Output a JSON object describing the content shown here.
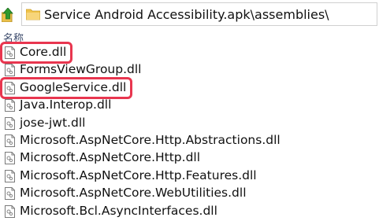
{
  "address_bar": {
    "up_icon": "green-up-arrow-icon",
    "folder_icon": "folder-icon",
    "path": "Service Android Accessibility.apk\\assemblies\\"
  },
  "list": {
    "column_header": "名称",
    "files": [
      {
        "name": "Core.dll",
        "icon": "dll-file-icon",
        "highlighted": true
      },
      {
        "name": "FormsViewGroup.dll",
        "icon": "dll-file-icon",
        "highlighted": false
      },
      {
        "name": "GoogleService.dll",
        "icon": "dll-file-icon",
        "highlighted": true
      },
      {
        "name": "Java.Interop.dll",
        "icon": "dll-file-icon",
        "highlighted": false
      },
      {
        "name": "jose-jwt.dll",
        "icon": "dll-file-icon",
        "highlighted": false
      },
      {
        "name": "Microsoft.AspNetCore.Http.Abstractions.dll",
        "icon": "dll-file-icon",
        "highlighted": false
      },
      {
        "name": "Microsoft.AspNetCore.Http.dll",
        "icon": "dll-file-icon",
        "highlighted": false
      },
      {
        "name": "Microsoft.AspNetCore.Http.Features.dll",
        "icon": "dll-file-icon",
        "highlighted": false
      },
      {
        "name": "Microsoft.AspNetCore.WebUtilities.dll",
        "icon": "dll-file-icon",
        "highlighted": false
      },
      {
        "name": "Microsoft.Bcl.AsyncInterfaces.dll",
        "icon": "dll-file-icon",
        "highlighted": false
      }
    ]
  },
  "colors": {
    "highlight": "#e8364f",
    "header_text": "#3b4a6b",
    "text": "#111111"
  }
}
